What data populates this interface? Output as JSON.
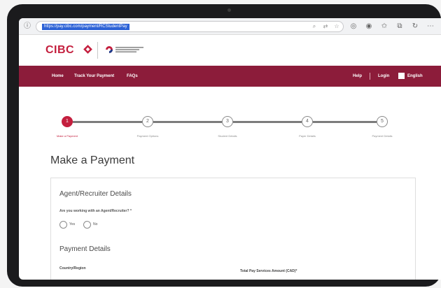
{
  "browser": {
    "url": "https://pay.cibc.com/payment/RCStudentPay"
  },
  "site": {
    "logo_text": "CIBC",
    "nav": {
      "home": "Home",
      "track_payment": "Track Your Payment",
      "faqs": "FAQs",
      "help": "Help",
      "login": "Login",
      "language": "English"
    }
  },
  "stepper": {
    "steps": [
      {
        "number": "1",
        "label": "Make a Payment"
      },
      {
        "number": "2",
        "label": "Payment Options"
      },
      {
        "number": "3",
        "label": "Student Details"
      },
      {
        "number": "4",
        "label": "Payer Details"
      },
      {
        "number": "5",
        "label": "Payment Details"
      }
    ],
    "active_step": 1
  },
  "page": {
    "title": "Make a Payment",
    "agent_section_title": "Agent/Recruiter Details",
    "agent_question": "Are you working with an Agent/Recruiter? *",
    "radio_yes": "Yes",
    "radio_no": "No",
    "payment_section_title": "Payment Details",
    "country_label": "Country/Region",
    "amount_label": "Total Pay Services Amount (CAD)*"
  },
  "colors": {
    "brand_red": "#c41f3e",
    "nav_maroon": "#8c1c3a",
    "url_highlight": "#2d62d6"
  }
}
